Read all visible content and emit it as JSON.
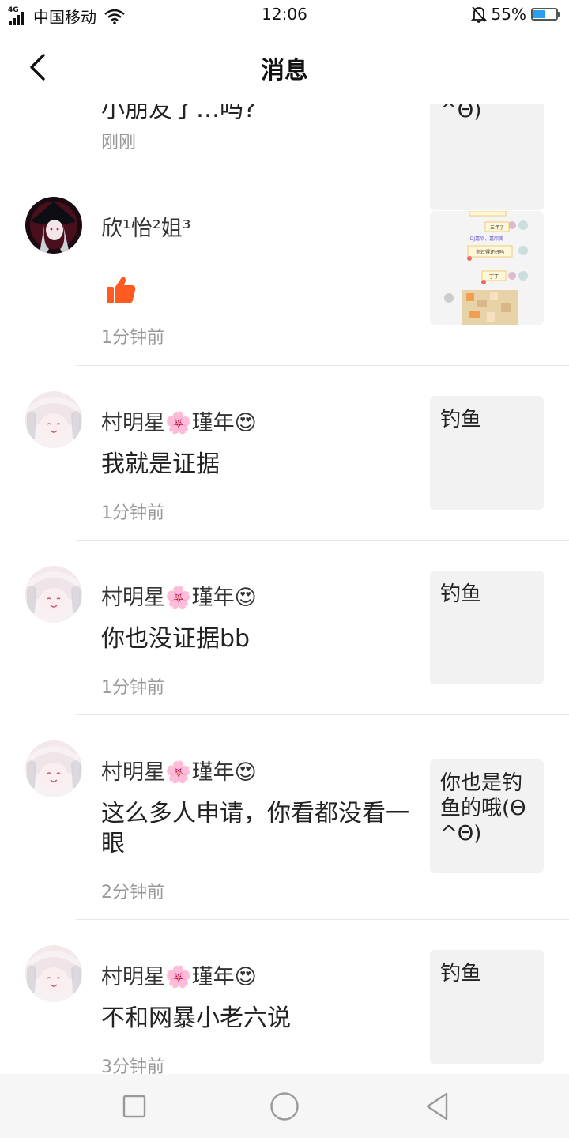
{
  "status_bar": {
    "network": "4G",
    "carrier": "中国移动",
    "time": "12:06",
    "battery": "55%",
    "battery_level": 0.55
  },
  "header": {
    "title": "消息"
  },
  "messages": [
    {
      "message": "小朋友了…吗?",
      "time": "刚刚",
      "thumb_text": "^Θ)"
    },
    {
      "name": "欣¹怡²姐³",
      "message": "",
      "time": "1分钟前",
      "thumb_kind": "image",
      "thumb_image_texts": [
        "三年了",
        "DJ嘉欣，嘉欣美",
        "你过得还好吗",
        "丁丁"
      ]
    },
    {
      "name": "村明星🌸瑾年😍",
      "message": "我就是证据",
      "time": "1分钟前",
      "thumb_text": "钓鱼"
    },
    {
      "name": "村明星🌸瑾年😍",
      "message": "你也没证据bb",
      "time": "1分钟前",
      "thumb_text": "钓鱼"
    },
    {
      "name": "村明星🌸瑾年😍",
      "message": "这么多人申请，你看都没看一眼",
      "time": "2分钟前",
      "thumb_text": "你也是钓鱼的哦(Θ^Θ)"
    },
    {
      "name": "村明星🌸瑾年😍",
      "message": "不和网暴小老六说",
      "time": "3分钟前",
      "thumb_text": "钓鱼"
    }
  ],
  "colors": {
    "like": "#ff5a1f",
    "divider": "#e8e8e8",
    "time_text": "#999999",
    "battery_fill": "#2aa0f0"
  }
}
